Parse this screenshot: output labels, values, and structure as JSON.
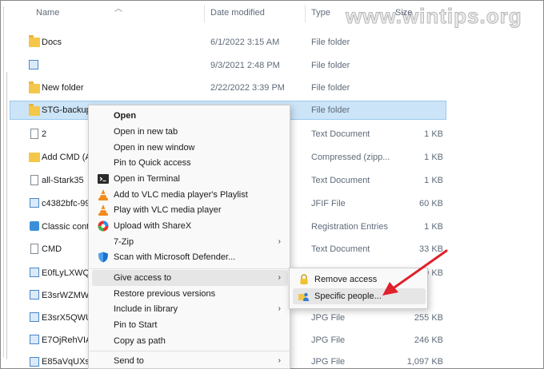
{
  "watermark": "www.wintips.org",
  "columns": {
    "name": "Name",
    "date": "Date modified",
    "type": "Type",
    "size": "Size"
  },
  "files": [
    {
      "name": "Docs",
      "date": "6/1/2022 3:15 AM",
      "type": "File folder",
      "size": "",
      "icon": "folder-icon"
    },
    {
      "name": "",
      "date": "9/3/2021 2:48 PM",
      "type": "File folder",
      "size": "",
      "icon": "image-folder-icon"
    },
    {
      "name": "New folder",
      "date": "2/22/2022 3:39 PM",
      "type": "File folder",
      "size": "",
      "icon": "folder-icon"
    },
    {
      "name": "STG-backups",
      "date": "",
      "type": "File folder",
      "size": "",
      "icon": "folder-icon",
      "selected": true
    },
    {
      "name": "2",
      "date": "",
      "type": "Text Document",
      "size": "1 KB",
      "icon": "text-document-icon"
    },
    {
      "name": "Add CMD (A",
      "date": "",
      "type": "Compressed (zipp...",
      "size": "1 KB",
      "icon": "zip-folder-icon"
    },
    {
      "name": "all-Stark35",
      "date": "",
      "type": "Text Document",
      "size": "1 KB",
      "icon": "text-document-icon"
    },
    {
      "name": "c4382bfc-99",
      "date": "",
      "type": "JFIF File",
      "size": "60 KB",
      "icon": "image-file-icon"
    },
    {
      "name": "Classic conte",
      "date": "",
      "type": "Registration Entries",
      "size": "1 KB",
      "icon": "registry-file-icon"
    },
    {
      "name": "CMD",
      "date": "",
      "type": "Text Document",
      "size": "33 KB",
      "icon": "text-document-icon"
    },
    {
      "name": "E0fLyLXWQA",
      "date": "",
      "type": "",
      "size": "9 KB",
      "icon": "image-file-icon"
    },
    {
      "name": "E3srWZMWU",
      "date": "",
      "type": "",
      "size": "",
      "icon": "image-file-icon"
    },
    {
      "name": "E3srX5QWUA",
      "date": "",
      "type": "JPG File",
      "size": "255 KB",
      "icon": "image-file-icon"
    },
    {
      "name": "E7OjRehVIA",
      "date": "",
      "type": "JPG File",
      "size": "246 KB",
      "icon": "image-file-icon"
    },
    {
      "name": "E85aVqUXsA",
      "date": "",
      "type": "JPG File",
      "size": "1,097 KB",
      "icon": "image-file-icon"
    }
  ],
  "context_menu": {
    "items": [
      {
        "label": "Open",
        "icon": "",
        "bold": true
      },
      {
        "label": "Open in new tab",
        "icon": ""
      },
      {
        "label": "Open in new window",
        "icon": ""
      },
      {
        "label": "Pin to Quick access",
        "icon": ""
      },
      {
        "label": "Open in Terminal",
        "icon": "terminal-icon"
      },
      {
        "label": "Add to VLC media player's Playlist",
        "icon": "vlc-icon"
      },
      {
        "label": "Play with VLC media player",
        "icon": "vlc-icon"
      },
      {
        "label": "Upload with ShareX",
        "icon": "sharex-icon"
      },
      {
        "label": "7-Zip",
        "icon": "",
        "submenu": true
      },
      {
        "label": "Scan with Microsoft Defender...",
        "icon": "defender-shield-icon"
      },
      {
        "label": "Give access to",
        "icon": "",
        "submenu": true,
        "highlighted": true
      },
      {
        "label": "Restore previous versions",
        "icon": ""
      },
      {
        "label": "Include in library",
        "icon": "",
        "submenu": true
      },
      {
        "label": "Pin to Start",
        "icon": ""
      },
      {
        "label": "Copy as path",
        "icon": ""
      },
      {
        "label": "Send to",
        "icon": "",
        "submenu": true
      }
    ]
  },
  "submenu": {
    "items": [
      {
        "label": "Remove access",
        "icon": "lock-icon"
      },
      {
        "label": "Specific people...",
        "icon": "people-icon",
        "highlighted": true
      }
    ]
  },
  "colors": {
    "selection": "#cce4f7",
    "selection_border": "#99c9ef",
    "arrow": "#e0202a",
    "highlight": "#e6e6e6"
  }
}
